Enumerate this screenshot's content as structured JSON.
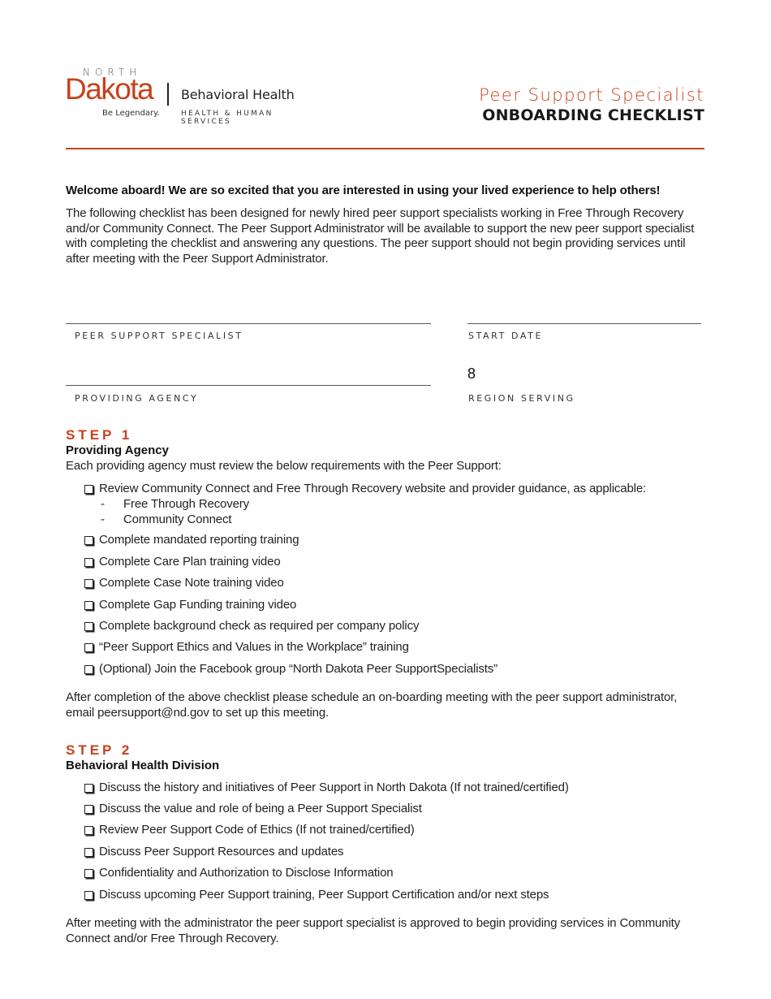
{
  "header": {
    "logo": {
      "north": "NORTH",
      "dakota": "Dakota",
      "tagline": "Be Legendary.",
      "division": "Behavioral Health",
      "department": "HEALTH & HUMAN SERVICES"
    },
    "title_sub": "Peer Support Specialist",
    "title_main": "ONBOARDING CHECKLIST"
  },
  "colors": {
    "accent": "#c8411b",
    "text": "#222222"
  },
  "intro": {
    "welcome": "Welcome aboard! We are so excited that you are interested in using your lived experience to help others!",
    "body": "The following checklist has been designed for newly hired peer support specialists working in Free Through Recovery and/or Community Connect. The Peer Support Administrator will be available to support the new peer support specialist with completing the checklist and answering any questions. The peer support should not begin providing services until after meeting with the Peer Support Administrator."
  },
  "fields": {
    "peer_support_specialist": {
      "label": "PEER SUPPORT SPECIALIST",
      "value": ""
    },
    "start_date": {
      "label": "START DATE",
      "value": ""
    },
    "providing_agency": {
      "label": "PROVIDING AGENCY",
      "value": ""
    },
    "region_serving": {
      "label": "REGION SERVING",
      "value": "8"
    }
  },
  "step1": {
    "heading": "STEP 1",
    "subheading": "Providing Agency",
    "intro": "Each providing agency must review the below requirements with the Peer Support:",
    "items": [
      {
        "label": "Review Community Connect and Free Through Recovery website and provider guidance, as applicable:",
        "sub_items": [
          "Free Through Recovery",
          "Community Connect"
        ]
      },
      {
        "label": "Complete mandated reporting training"
      },
      {
        "label": "Complete Care Plan training video"
      },
      {
        "label": "Complete Case Note training video"
      },
      {
        "label": "Complete Gap Funding training video"
      },
      {
        "label": "Complete background check as required per company policy"
      },
      {
        "label": "“Peer Support Ethics and Values in the Workplace” training"
      },
      {
        "label": "(Optional) Join the Facebook group “North Dakota Peer SupportSpecialists”"
      }
    ],
    "closing": "After completion of the above checklist please schedule an on-boarding meeting with the peer support administrator, email peersupport@nd.gov to set up this meeting."
  },
  "step2": {
    "heading": "STEP 2",
    "subheading": "Behavioral Health Division",
    "items": [
      {
        "label": "Discuss the history and initiatives of Peer Support in North Dakota (If not trained/certified)"
      },
      {
        "label": "Discuss the value and role of being a Peer Support Specialist"
      },
      {
        "label": "Review Peer Support Code of Ethics (If not trained/certified)"
      },
      {
        "label": "Discuss Peer Support Resources and updates"
      },
      {
        "label": "Confidentiality and Authorization to Disclose Information"
      },
      {
        "label": "Discuss upcoming Peer Support training, Peer Support Certification and/or next steps"
      }
    ],
    "closing": "After meeting with the administrator the peer support specialist is approved to begin providing services in Community Connect and/or Free Through Recovery."
  }
}
